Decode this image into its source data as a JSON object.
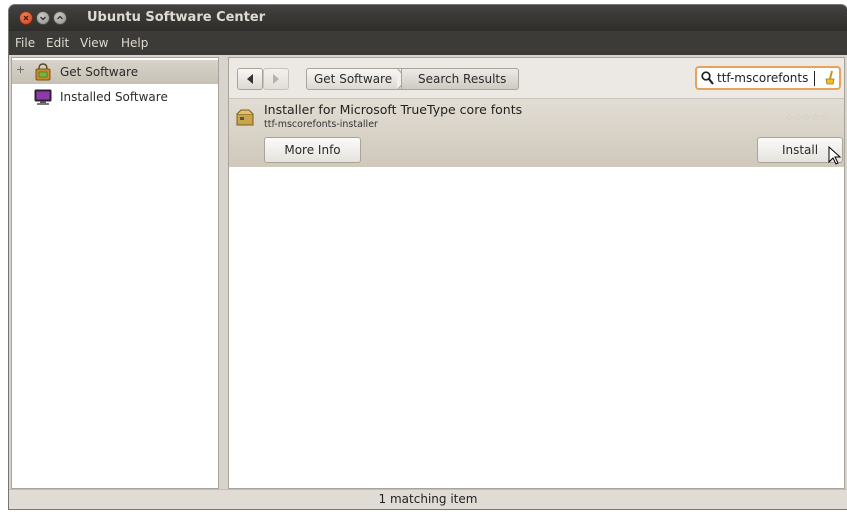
{
  "window": {
    "title": "Ubuntu Software Center",
    "controls": [
      "close-icon",
      "minimize-icon",
      "maximize-icon"
    ]
  },
  "menubar": {
    "items": [
      "File",
      "Edit",
      "View",
      "Help"
    ]
  },
  "sidebar": {
    "items": [
      {
        "label": "Get Software",
        "icon": "store-bag-icon",
        "selected": true,
        "expander": "+"
      },
      {
        "label": "Installed Software",
        "icon": "monitor-icon",
        "selected": false
      }
    ]
  },
  "navigation": {
    "back": "back-arrow-icon",
    "forward": "forward-arrow-icon",
    "breadcrumbs": [
      "Get Software",
      "Search Results"
    ]
  },
  "search": {
    "value": "ttf-mscorefonts",
    "search_icon": "magnifier-icon",
    "clear_icon": "clear-brush-icon"
  },
  "results": [
    {
      "name": "Installer for Microsoft TrueType core fonts",
      "package": "ttf-mscorefonts-installer",
      "rating_stars": 0,
      "more_info_label": "More Info",
      "install_label": "Install",
      "icon": "package-icon"
    }
  ],
  "status": {
    "text": "1 matching item"
  },
  "colors": {
    "chrome": "#3c3b37",
    "search_border": "#e8a25c",
    "close_button": "#e05a2a"
  }
}
